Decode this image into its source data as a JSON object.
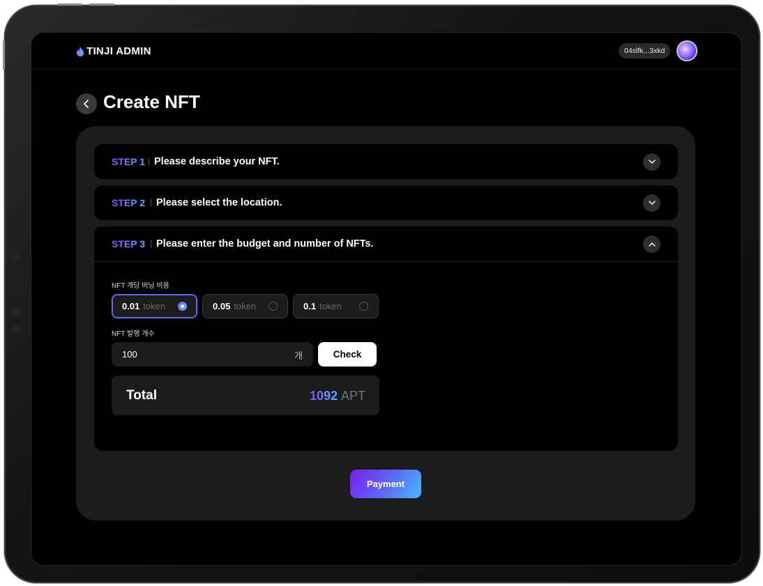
{
  "header": {
    "brand": "TINJI ADMIN",
    "wallet_address": "04slfk...3xkd"
  },
  "page": {
    "title": "Create NFT"
  },
  "steps": [
    {
      "label": "STEP 1",
      "title": "Please describe your NFT.",
      "expanded": false
    },
    {
      "label": "STEP 2",
      "title": "Please select the location.",
      "expanded": false
    },
    {
      "label": "STEP 3",
      "title": "Please enter the budget and number of NFTs.",
      "expanded": true
    }
  ],
  "budget": {
    "label": "NFT 개당 버닝 비용",
    "options": [
      {
        "value": "0.01",
        "unit": "token",
        "selected": true
      },
      {
        "value": "0.05",
        "unit": "token",
        "selected": false
      },
      {
        "value": "0.1",
        "unit": "token",
        "selected": false
      }
    ]
  },
  "quantity": {
    "label": "NFT 발행 개수",
    "value": "100",
    "unit": "개",
    "check_label": "Check"
  },
  "total": {
    "label": "Total",
    "amount": "1092",
    "unit": "APT"
  },
  "payment_label": "Payment",
  "colors": {
    "accent_gradient_start": "#8c4dff",
    "accent_gradient_end": "#4fb6ff",
    "background": "#000000",
    "card": "#1c1c1e"
  }
}
